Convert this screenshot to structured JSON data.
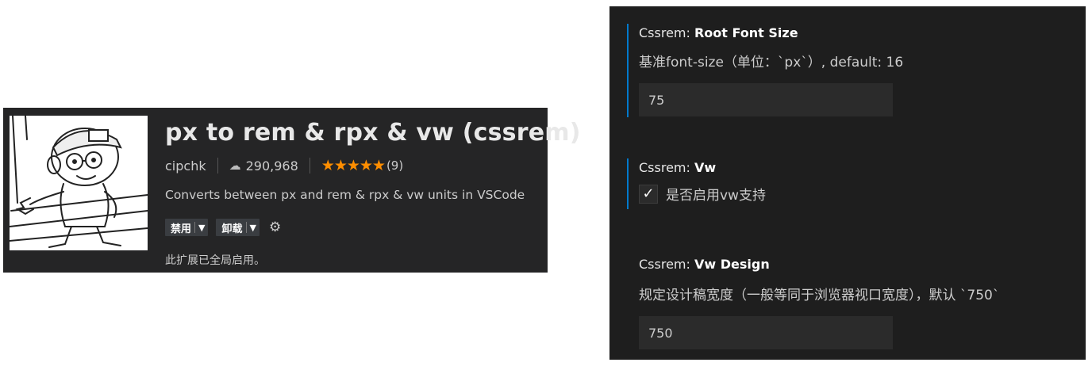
{
  "extension": {
    "title": "px to rem & rpx & vw (cssrem)",
    "publisher": "cipchk",
    "installs": "290,968",
    "stars": "★★★★★",
    "rating_count": "(9)",
    "description": "Converts between px and rem & rpx & vw units in VSCode",
    "disable_label": "禁用",
    "uninstall_label": "卸载",
    "status": "此扩展已全局启用。",
    "accent_star_color": "#ff8e00",
    "icons": {
      "download": "cloud-download-icon",
      "dropdown": "chevron-down-icon",
      "settings": "gear-icon"
    }
  },
  "settings": {
    "root_font_size": {
      "category": "Cssrem: ",
      "name": "Root Font Size",
      "description": "基准font-size（单位：`px`）, default: 16",
      "value": "75"
    },
    "vw": {
      "category": "Cssrem: ",
      "name": "Vw",
      "checkbox_label": "是否启用vw支持",
      "checked": true
    },
    "vw_design": {
      "category": "Cssrem: ",
      "name": "Vw Design",
      "description": "规定设计稿宽度（一般等同于浏览器视口宽度），默认 `750`",
      "value": "750"
    },
    "focus_color": "#007acc"
  }
}
